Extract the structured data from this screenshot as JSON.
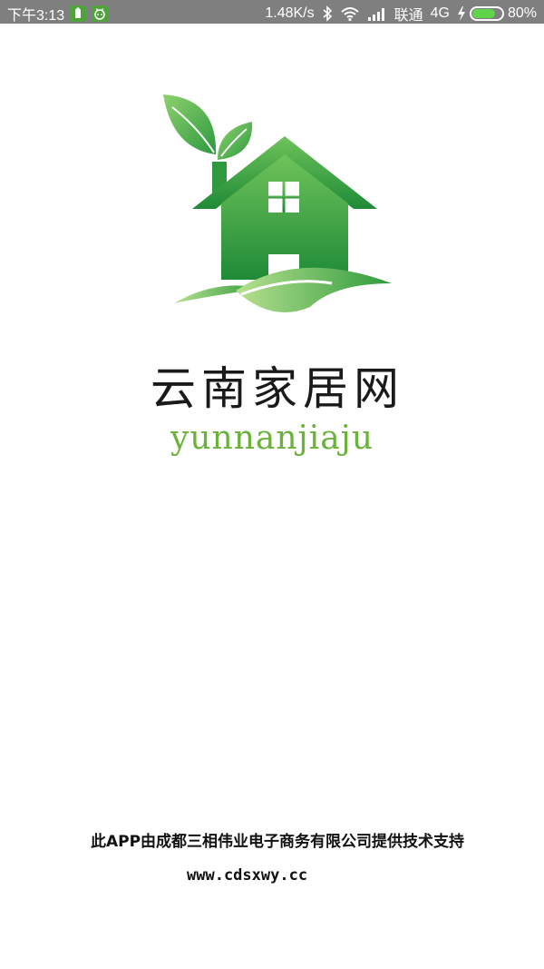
{
  "status_bar": {
    "time": "下午3:13",
    "network_speed": "1.48K/s",
    "carrier": "联通",
    "network_type": "4G",
    "battery_percent": "80%",
    "battery_level": 0.8,
    "icons": [
      "battery-saver-icon",
      "android-icon",
      "bluetooth-icon",
      "wifi-icon",
      "signal-icon",
      "charging-icon"
    ]
  },
  "splash": {
    "app_name": "云南家居网",
    "app_subtitle": "yunnanjiaju",
    "support_text": "此APP由成都三相伟业电子商务有限公司提供技术支持",
    "support_url": "www.cdsxwy.cc"
  },
  "colors": {
    "status_bar_bg": "#7f7f7f",
    "brand_green": "#2e9a3a",
    "subtitle_green": "#6bb23a"
  }
}
